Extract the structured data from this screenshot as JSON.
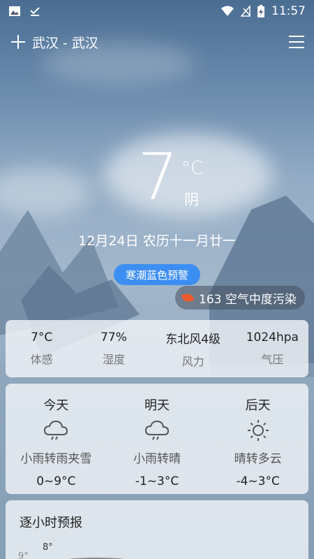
{
  "status_bar": {
    "time": "11:57"
  },
  "header": {
    "city": "武汉 - 武汉"
  },
  "current": {
    "temp": "7",
    "unit": "°C",
    "condition": "阴",
    "date_line": "12月24日 农历十一月廿一",
    "warning": "寒潮蓝色预警",
    "aqi": "163 空气中度污染"
  },
  "details": [
    {
      "value": "7°C",
      "label": "体感"
    },
    {
      "value": "77%",
      "label": "湿度"
    },
    {
      "value": "东北风4级",
      "label": "风力"
    },
    {
      "value": "1024hpa",
      "label": "气压"
    }
  ],
  "forecast": [
    {
      "day": "今天",
      "icon": "cloud-rain-icon",
      "desc": "小雨转雨夹雪",
      "temp": "0~9°C"
    },
    {
      "day": "明天",
      "icon": "cloud-rain-icon",
      "desc": "小雨转晴",
      "temp": "-1~3°C"
    },
    {
      "day": "后天",
      "icon": "sun-icon",
      "desc": "晴转多云",
      "temp": "-4~3°C"
    }
  ],
  "hourly": {
    "title": "逐小时预报",
    "peek_labels": [
      "8°",
      "9°"
    ]
  }
}
